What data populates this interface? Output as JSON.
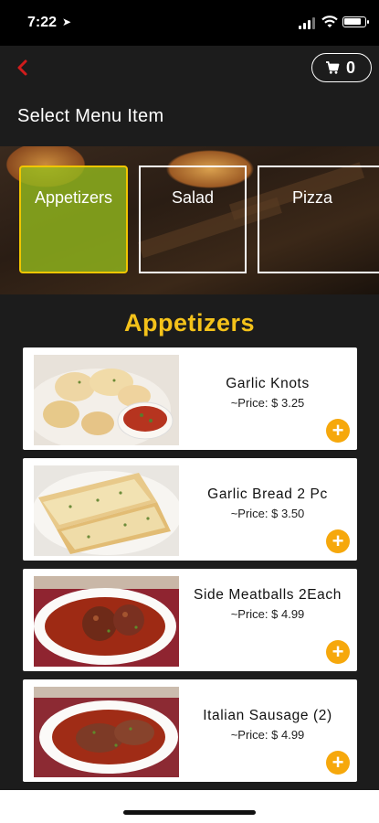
{
  "status_bar": {
    "time": "7:22",
    "location_glyph": "➤"
  },
  "header": {
    "back_glyph": "‹",
    "cart_count": "0",
    "title": "Select Menu Item"
  },
  "categories": [
    {
      "label": "Appetizers",
      "selected": true
    },
    {
      "label": "Salad",
      "selected": false
    },
    {
      "label": "Pizza",
      "selected": false
    }
  ],
  "section": {
    "title": "Appetizers"
  },
  "items": [
    {
      "name": "Garlic Knots",
      "price": "~Price: $ 3.25",
      "add": "+"
    },
    {
      "name": "Garlic Bread 2 Pc",
      "price": "~Price: $ 3.50",
      "add": "+"
    },
    {
      "name": "Side Meatballs 2Each",
      "price": "~Price: $ 4.99",
      "add": "+"
    },
    {
      "name": "Italian Sausage (2)",
      "price": "~Price: $ 4.99",
      "add": "+"
    }
  ],
  "colors": {
    "accent": "#f4c21a",
    "add_button": "#f6a80c",
    "back": "#d01c1c",
    "selected_tile": "#96be1e"
  },
  "icons": [
    "location-arrow-icon",
    "signal-icon",
    "wifi-icon",
    "battery-icon",
    "back-chevron-icon",
    "cart-icon",
    "plus-icon"
  ]
}
